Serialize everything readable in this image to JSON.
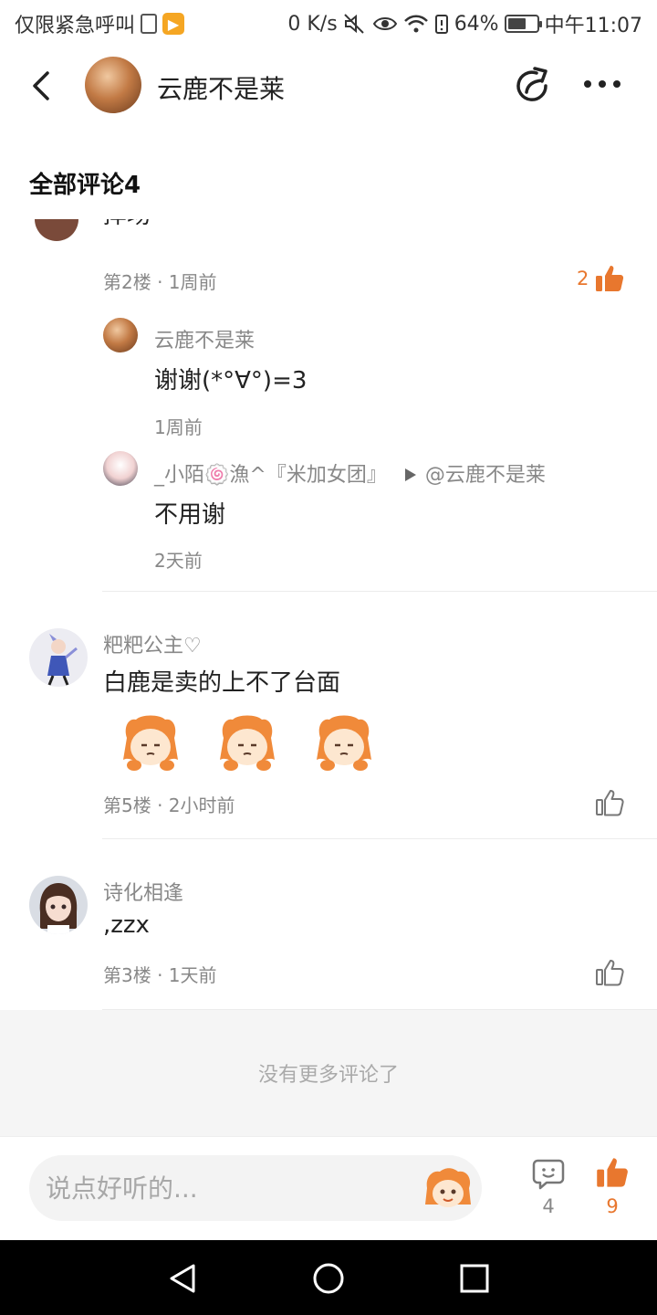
{
  "status_bar": {
    "carrier_text": "仅限紧急呼叫",
    "speed": "0 K/s",
    "battery": "64%",
    "battery_level": 0.64,
    "time": "中午11:07"
  },
  "header": {
    "title": "云鹿不是莱"
  },
  "section": {
    "title": "全部评论4"
  },
  "comments": {
    "partial": {
      "text_fragment": "摔场",
      "floor_time": "第2楼 · 1周前",
      "like_count": "2"
    },
    "replies": [
      {
        "author": "云鹿不是莱",
        "text": "谢谢(*°∀°)=3",
        "time": "1周前"
      },
      {
        "author": "_小陌🍥漁^『米加女团』",
        "mention": "@云鹿不是莱",
        "text": "不用谢",
        "time": "2天前"
      }
    ],
    "items": [
      {
        "author": "粑粑公主♡",
        "text": "白鹿是卖的上不了台面",
        "floor_time": "第5楼 · 2小时前"
      },
      {
        "author": "诗化相逢",
        "text": ",zzx",
        "floor_time": "第3楼 · 1天前"
      }
    ],
    "end_text": "没有更多评论了"
  },
  "bottom_bar": {
    "input_placeholder": "说点好听的...",
    "comment_count": "4",
    "like_count": "9"
  },
  "colors": {
    "accent": "#e8772e",
    "muted": "#888888",
    "background_end": "#f5f5f5"
  }
}
